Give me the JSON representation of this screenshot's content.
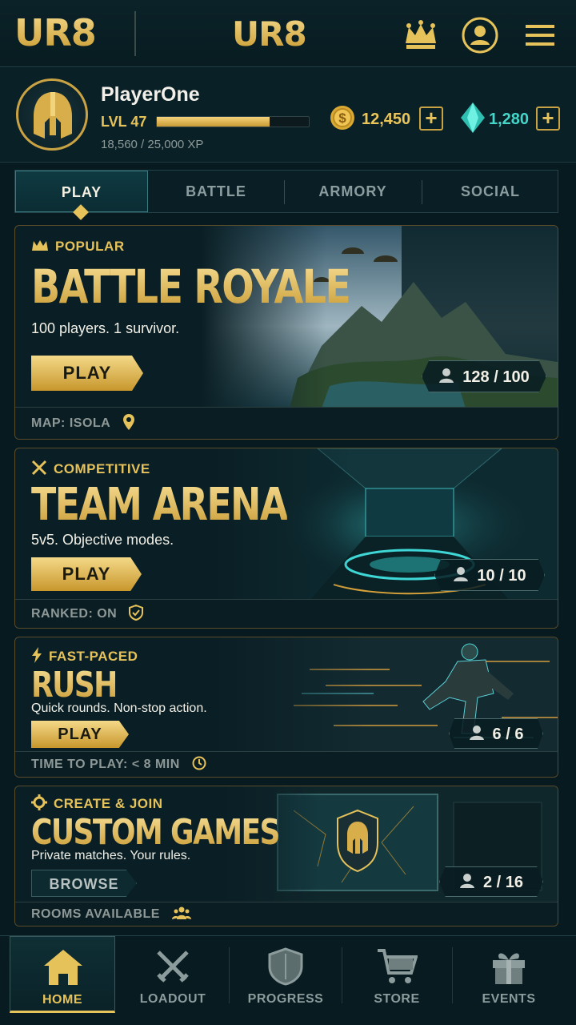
{
  "header": {
    "logo_left": "UR8",
    "logo_center": "UR8",
    "icons": [
      "crown-icon",
      "profile-icon",
      "menu-icon"
    ]
  },
  "player": {
    "name": "PlayerOne",
    "level": "LVL 47",
    "xp": "18,560 / 25,000 XP",
    "xp_progress": 0.74,
    "coins": "12,450",
    "gems": "1,280",
    "plus": "+"
  },
  "tabs": [
    "PLAY",
    "BATTLE",
    "ARMORY",
    "SOCIAL"
  ],
  "modes": [
    {
      "tag": "POPULAR",
      "title": "BATTLE ROYALE",
      "subtitle": "100 players. 1 survivor.",
      "button": "PLAY",
      "count": "128 / 100",
      "footer": "MAP: ISOLA"
    },
    {
      "tag": "COMPETITIVE",
      "title": "TEAM ARENA",
      "subtitle": "5v5. Objective modes.",
      "button": "PLAY",
      "count": "10 / 10",
      "footer": "RANKED: ON"
    },
    {
      "tag": "FAST-PACED",
      "title": "RUSH",
      "subtitle": "Quick rounds. Non-stop action.",
      "button": "PLAY",
      "count": "6 / 6",
      "footer": "TIME TO PLAY: < 8 MIN"
    },
    {
      "tag": "CREATE & JOIN",
      "title": "CUSTOM GAMES",
      "subtitle": "Private matches. Your rules.",
      "button": "BROWSE",
      "count": "2 / 16",
      "footer": "ROOMS AVAILABLE"
    }
  ],
  "nav": [
    "HOME",
    "LOADOUT",
    "PROGRESS",
    "STORE",
    "EVENTS"
  ],
  "colors": {
    "gold": "#e6c25a",
    "teal": "#44d6c8",
    "background": "#071a1f"
  }
}
